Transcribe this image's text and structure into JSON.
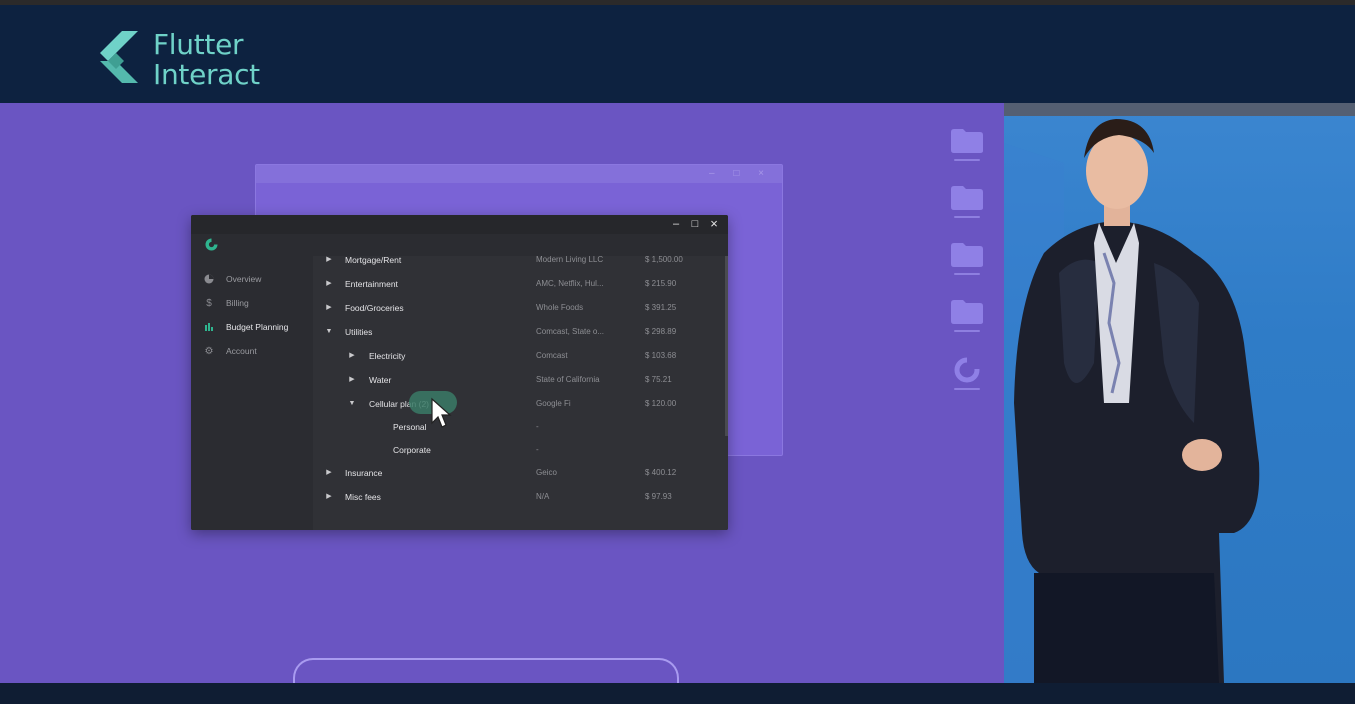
{
  "event": {
    "brand_line1": "Flutter",
    "brand_line2": "Interact"
  },
  "window_controls": {
    "minimize": "–",
    "maximize": "□",
    "close": "×"
  },
  "sidebar": {
    "items": [
      {
        "label": "Overview",
        "icon": "pie-chart-icon"
      },
      {
        "label": "Billing",
        "icon": "dollar-icon"
      },
      {
        "label": "Budget Planning",
        "icon": "bar-chart-icon",
        "active": true
      },
      {
        "label": "Account",
        "icon": "gear-icon"
      }
    ]
  },
  "budget": {
    "rows": [
      {
        "name": "Mortgage/Rent",
        "vendor": "Modern Living LLC",
        "amount": "$  1,500.00",
        "expanded": false,
        "level": 0
      },
      {
        "name": "Entertainment",
        "vendor": "AMC, Netflix, Hul...",
        "amount": "$  215.90",
        "expanded": false,
        "level": 0
      },
      {
        "name": "Food/Groceries",
        "vendor": "Whole Foods",
        "amount": "$  391.25",
        "expanded": false,
        "level": 0
      },
      {
        "name": "Utilities",
        "vendor": "Comcast, State o...",
        "amount": "$  298.89",
        "expanded": true,
        "level": 0
      },
      {
        "name": "Electricity",
        "vendor": "Comcast",
        "amount": "$  103.68",
        "expanded": false,
        "level": 1
      },
      {
        "name": "Water",
        "vendor": "State of California",
        "amount": "$  75.21",
        "expanded": false,
        "level": 1
      },
      {
        "name": "Cellular plan (2)",
        "vendor": "Google Fi",
        "amount": "$  120.00",
        "expanded": true,
        "level": 1
      },
      {
        "name": "Personal",
        "vendor": "-",
        "amount": "",
        "level": 2
      },
      {
        "name": "Corporate",
        "vendor": "-",
        "amount": "",
        "level": 2
      },
      {
        "name": "Insurance",
        "vendor": "Geico",
        "amount": "$ 400.12",
        "expanded": false,
        "level": 0
      },
      {
        "name": "Misc fees",
        "vendor": "N/A",
        "amount": "$ 97.93",
        "expanded": false,
        "level": 0
      }
    ]
  },
  "colors": {
    "brand_teal": "#6fd2c8",
    "stage_purple": "#6a55c2",
    "header_navy": "#0d2240",
    "app_dark": "#2d2e33",
    "highlight_green": "#3a7a66"
  }
}
